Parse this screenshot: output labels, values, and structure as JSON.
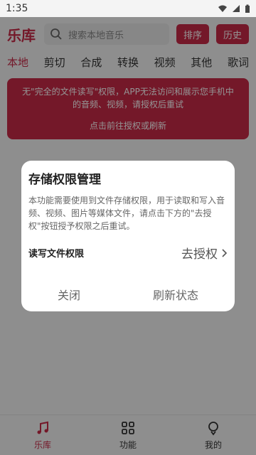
{
  "status": {
    "time": "1:35"
  },
  "header": {
    "title": "乐库",
    "search_placeholder": "搜索本地音乐",
    "sort_label": "排序",
    "history_label": "历史"
  },
  "tabs": [
    "本地",
    "剪切",
    "合成",
    "转换",
    "视频",
    "其他",
    "歌词"
  ],
  "alert": {
    "message": "无\"完全的文件读写\"权限，APP无法访问和展示您手机中的音频、视频，请授权后重试",
    "action": "点击前往授权或刷新"
  },
  "dialog": {
    "title": "存储权限管理",
    "message": "本功能需要使用到文件存储权限，用于读取和写入音频、视频、图片等媒体文件，请点击下方的\"去授权\"按钮授予权限之后重试。",
    "permission_label": "读写文件权限",
    "permission_action": "去授权",
    "close_label": "关闭",
    "refresh_label": "刷新状态"
  },
  "bottom_nav": [
    {
      "label": "乐库",
      "icon": "music-note-icon",
      "active": true
    },
    {
      "label": "功能",
      "icon": "grid-icon",
      "active": false
    },
    {
      "label": "我的",
      "icon": "profile-icon",
      "active": false
    }
  ],
  "colors": {
    "accent": "#c92a48",
    "overlay": "rgba(0,0,0,0.42)"
  }
}
